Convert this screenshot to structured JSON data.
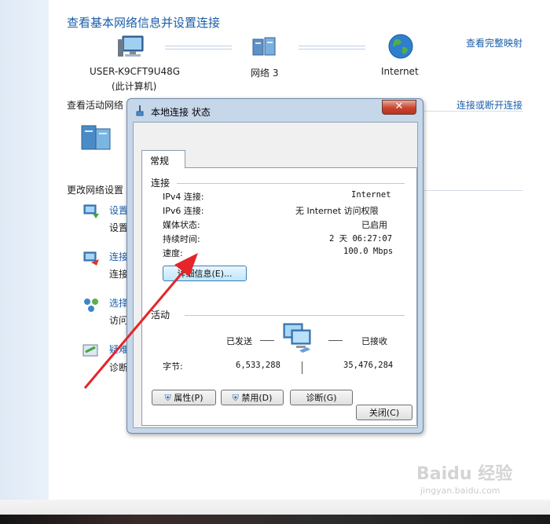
{
  "network_center": {
    "title": "查看基本网络信息并设置连接",
    "view_full_map": "查看完整映射",
    "computer_name": "USER-K9CFT9U48G",
    "computer_sub": "(此计算机)",
    "network_name": "网络  3",
    "internet_label": "Internet",
    "active_networks": "查看活动网络",
    "connect_disconnect": "连接或断开连接",
    "change_settings": "更改网络设置",
    "task_items": [
      {
        "title": "设置",
        "desc": "设置"
      },
      {
        "title": "连接",
        "desc": "连接"
      },
      {
        "title": "选择",
        "desc": "访问"
      },
      {
        "title": "疑难",
        "desc": "诊断"
      }
    ]
  },
  "dialog": {
    "title": "本地连接 状态",
    "close_glyph": "✕",
    "tab_general": "常规",
    "group_connection": "连接",
    "rows": [
      {
        "label": "IPv4 连接:",
        "value": "Internet"
      },
      {
        "label": "IPv6 连接:",
        "value": "无 Internet 访问权限"
      },
      {
        "label": "媒体状态:",
        "value": "已启用"
      },
      {
        "label": "持续时间:",
        "value": "2 天 06:27:07"
      },
      {
        "label": "速度:",
        "value": "100.0 Mbps"
      }
    ],
    "details_button": "详细信息(E)...",
    "group_activity": "活动",
    "sent_label": "已发送",
    "received_label": "已接收",
    "bytes_label": "字节:",
    "bytes_sent": "6,533,288",
    "bytes_received": "35,476,284",
    "properties_button": "属性(P)",
    "disable_button": "禁用(D)",
    "diagnose_button": "诊断(G)",
    "close_button": "关闭(C)"
  },
  "watermark": {
    "text": "Baidu 经验",
    "sub": "jingyan.baidu.com"
  },
  "colors": {
    "link": "#1a5ea8",
    "arrow": "#e5252a",
    "dialog_frame": "#c6d7ea"
  }
}
